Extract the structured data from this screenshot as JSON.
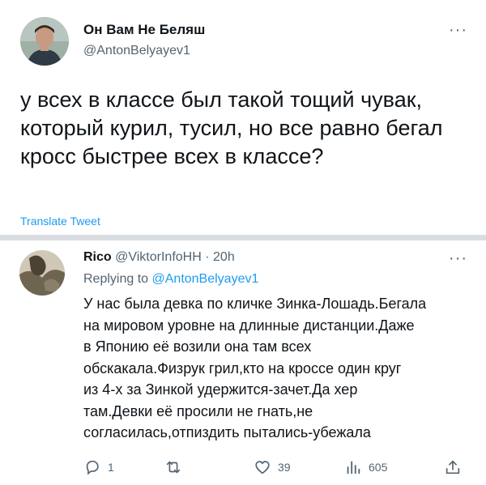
{
  "main_tweet": {
    "display_name": "Он Вам Не Беляш",
    "handle": "@AntonBelyayev1",
    "text": "у всех в классе был такой тощий чувак, который курил, тусил, но все равно бегал кросс быстрее всех в классе?",
    "translate_label": "Translate Tweet",
    "more_label": "···"
  },
  "reply": {
    "display_name": "Rico",
    "handle": "@ViktorInfoHH",
    "separator": "·",
    "time": "20h",
    "replying_prefix": "Replying to",
    "replying_handle": "@AntonBelyayev1",
    "more_label": "···",
    "lines": [
      "У нас была девка по кличке Зинка-Лошадь.Бегала",
      "на мировом уровне на длинные дистанции.Даже",
      "в Японию её возили она там всех",
      "обскакала.Физрук грил,кто на кроссе один круг",
      "из 4-х за Зинкой удержится-зачет.Да хер",
      "там.Девки её просили не гнать,не",
      "согласилась,отпиздить пытались-убежала"
    ]
  },
  "actions": {
    "reply_count": "1",
    "retweet_count": "",
    "like_count": "39",
    "views_count": "605",
    "icons": [
      "reply-icon",
      "retweet-icon",
      "like-icon",
      "views-icon",
      "share-icon"
    ]
  },
  "colors": {
    "text": "#0f1419",
    "secondary": "#536471",
    "link": "#1d9bf0",
    "divider": "#d9dde1"
  }
}
